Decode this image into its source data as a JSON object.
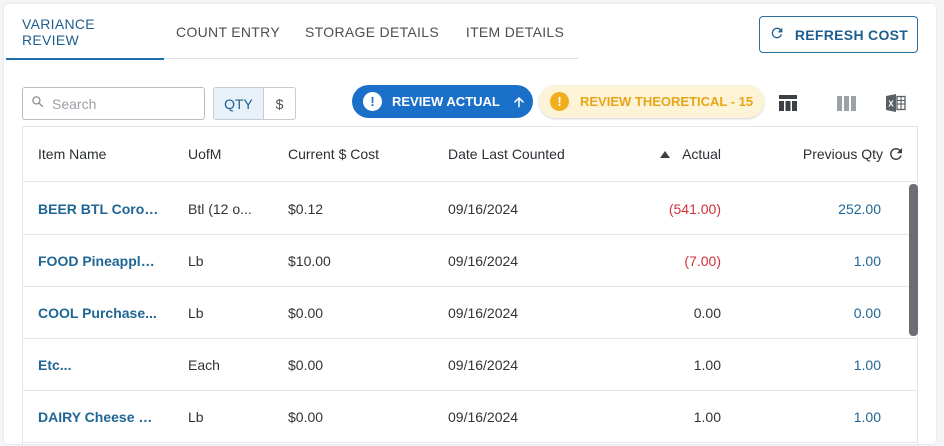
{
  "tabs": [
    {
      "label": "VARIANCE REVIEW",
      "active": true
    },
    {
      "label": "COUNT ENTRY",
      "active": false
    },
    {
      "label": "STORAGE DETAILS",
      "active": false
    },
    {
      "label": "ITEM DETAILS",
      "active": false
    }
  ],
  "refresh_button": {
    "label": "REFRESH COST",
    "icon": "refresh-icon"
  },
  "search": {
    "placeholder": "Search",
    "value": ""
  },
  "mode_toggle": {
    "qty_label": "QTY",
    "dollar_label": "$",
    "selected": "QTY"
  },
  "review_actual": {
    "label": "REVIEW ACTUAL",
    "icon": "alert-icon",
    "sort_icon": "arrow-up-icon"
  },
  "review_theoretical": {
    "label": "REVIEW THEORETICAL - 15",
    "icon": "alert-icon"
  },
  "toolbar_icons": [
    "table-layout-icon",
    "columns-icon",
    "excel-export-icon"
  ],
  "colors": {
    "accent": "#1f6fa8",
    "actual_pill": "#1a6fc9",
    "theoretical_pill_bg": "#fdf3d6",
    "theoretical_text": "#e7a51a",
    "negative": "#d2303b"
  },
  "table": {
    "columns": {
      "name": "Item Name",
      "uom": "UofM",
      "cost": "Current $ Cost",
      "date": "Date Last Counted",
      "actual": "Actual",
      "prev": "Previous Qty"
    },
    "sort": {
      "column": "Actual",
      "direction": "ascending"
    },
    "rows": [
      {
        "name": "BEER BTL Coron...",
        "uom": "Btl (12 o...",
        "cost": "$0.12",
        "date": "09/16/2024",
        "actual": "(541.00)",
        "prev": "252.00"
      },
      {
        "name": "FOOD Pineapple ...",
        "uom": "Lb",
        "cost": "$10.00",
        "date": "09/16/2024",
        "actual": "(7.00)",
        "prev": "1.00"
      },
      {
        "name": "COOL Purchase...",
        "uom": "Lb",
        "cost": "$0.00",
        "date": "09/16/2024",
        "actual": "0.00",
        "prev": "0.00"
      },
      {
        "name": "Etc...",
        "uom": "Each",
        "cost": "$0.00",
        "date": "09/16/2024",
        "actual": "1.00",
        "prev": "1.00"
      },
      {
        "name": "DAIRY Cheese C...",
        "uom": "Lb",
        "cost": "$0.00",
        "date": "09/16/2024",
        "actual": "1.00",
        "prev": "1.00"
      }
    ]
  }
}
